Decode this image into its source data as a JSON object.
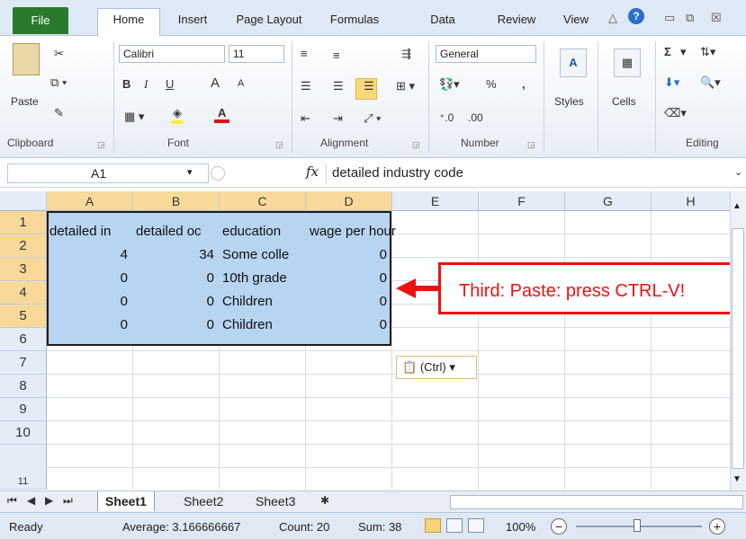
{
  "ribbon_tabs": [
    "File",
    "Home",
    "Insert",
    "Page Layout",
    "Formulas",
    "Data",
    "Review",
    "View"
  ],
  "ribbon": {
    "clipboard": {
      "label": "Clipboard",
      "paste": "Paste"
    },
    "font": {
      "label": "Font",
      "name": "Calibri",
      "size": "11",
      "bold": "B",
      "italic": "I",
      "underline": "U",
      "grow": "A",
      "shrink": "A",
      "color": "A"
    },
    "alignment": {
      "label": "Alignment"
    },
    "number": {
      "label": "Number",
      "format": "General",
      "percent": "%",
      "comma": ","
    },
    "styles": {
      "label": "Styles"
    },
    "cells": {
      "label": "Cells"
    },
    "editing": {
      "label": "Editing",
      "sum": "Σ"
    }
  },
  "formula_bar": {
    "name_box": "A1",
    "fx": "fx",
    "formula": "detailed industry code"
  },
  "columns": [
    "A",
    "B",
    "C",
    "D",
    "E",
    "F",
    "G",
    "H"
  ],
  "rows": [
    "1",
    "2",
    "3",
    "4",
    "5",
    "6",
    "7",
    "8",
    "9",
    "10",
    "11"
  ],
  "cells": {
    "a1": "detailed in",
    "b1": "detailed oc",
    "c1": "education",
    "d1": "wage per hour",
    "a2": "4",
    "b2": "34",
    "c2": "Some colle",
    "d2": "0",
    "a3": "0",
    "b3": "0",
    "c3": "10th grade",
    "d3": "0",
    "a4": "0",
    "b4": "0",
    "c4": "Children",
    "d4": "0",
    "a5": "0",
    "b5": "0",
    "c5": "Children",
    "d5": "0"
  },
  "annotation": "Third: Paste: press CTRL-V!",
  "paste_options": "(Ctrl)",
  "sheets": [
    "Sheet1",
    "Sheet2",
    "Sheet3"
  ],
  "status": {
    "ready": "Ready",
    "average": "Average: 3.166666667",
    "count": "Count: 20",
    "sum": "Sum: 38",
    "zoom": "100%"
  },
  "colors": {
    "accent": "#2a7a2e",
    "selection": "#b7d4f0",
    "annotation": "#ee1111",
    "header_selected": "#f9d99a"
  }
}
